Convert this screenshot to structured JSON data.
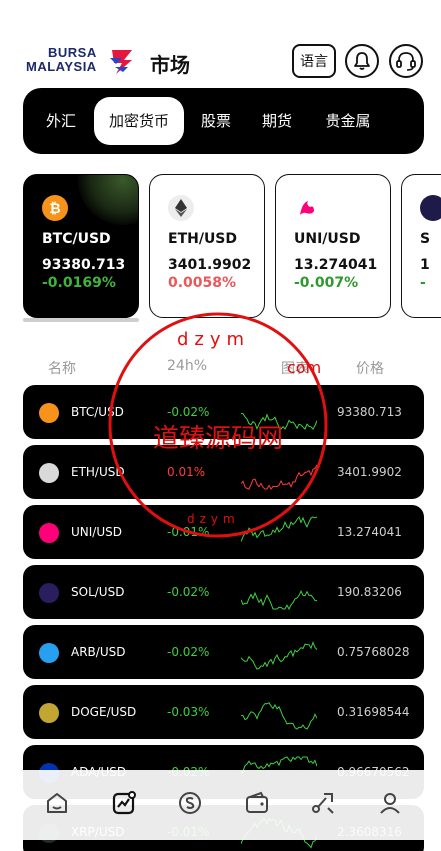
{
  "header": {
    "logo_line1": "BURSA",
    "logo_line2": "MALAYSIA",
    "title": "市场",
    "lang_label": "语言"
  },
  "tabs": [
    {
      "label": "外汇",
      "active": false
    },
    {
      "label": "加密货币",
      "active": true
    },
    {
      "label": "股票",
      "active": false
    },
    {
      "label": "期货",
      "active": false
    },
    {
      "label": "贵金属",
      "active": false
    }
  ],
  "cards": [
    {
      "pair": "BTC/USD",
      "price": "93380.713",
      "change": "-0.0169%",
      "change_color": "#3fb53f",
      "coin_color": "#f7931a",
      "dark": true
    },
    {
      "pair": "ETH/USD",
      "price": "3401.9902",
      "change": "0.0058%",
      "change_color": "#e65a5a",
      "coin_color": "#ededed",
      "dark": false
    },
    {
      "pair": "UNI/USD",
      "price": "13.274041",
      "change": "-0.007%",
      "change_color": "#2e9a2e",
      "coin_color": "#ffffff",
      "dark": false
    },
    {
      "pair": "S",
      "price": "1",
      "change": "-",
      "change_color": "#2e9a2e",
      "coin_color": "#1e1b4b",
      "dark": false
    }
  ],
  "table_header": {
    "name": "名称",
    "change": "24h%",
    "chart": "图表",
    "price": "价格"
  },
  "rows": [
    {
      "pair": "BTC/USD",
      "change": "-0.02%",
      "change_color": "#3fd13f",
      "price": "93380.713",
      "spark_color": "#3fd13f",
      "coin_color": "#f7931a",
      "icon": "bitcoin-icon"
    },
    {
      "pair": "ETH/USD",
      "change": "0.01%",
      "change_color": "#ff3b3b",
      "price": "3401.9902",
      "spark_color": "#ff3b3b",
      "coin_color": "#d9d9d9",
      "icon": "ethereum-icon"
    },
    {
      "pair": "UNI/USD",
      "change": "-0.01%",
      "change_color": "#3fd13f",
      "price": "13.274041",
      "spark_color": "#3fd13f",
      "coin_color": "#ff007a",
      "icon": "uniswap-icon"
    },
    {
      "pair": "SOL/USD",
      "change": "-0.02%",
      "change_color": "#3fd13f",
      "price": "190.83206",
      "spark_color": "#3fd13f",
      "coin_color": "#2a1f5c",
      "icon": "solana-icon"
    },
    {
      "pair": "ARB/USD",
      "change": "-0.02%",
      "change_color": "#3fd13f",
      "price": "0.75768028",
      "spark_color": "#3fd13f",
      "coin_color": "#28a0f0",
      "icon": "arbitrum-icon"
    },
    {
      "pair": "DOGE/USD",
      "change": "-0.03%",
      "change_color": "#3fd13f",
      "price": "0.31698544",
      "spark_color": "#3fd13f",
      "coin_color": "#c2a633",
      "icon": "dogecoin-icon"
    },
    {
      "pair": "ADA/USD",
      "change": "-0.02%",
      "change_color": "#3fd13f",
      "price": "0.96670562",
      "spark_color": "#3fd13f",
      "coin_color": "#0033ad",
      "icon": "cardano-icon"
    },
    {
      "pair": "XRP/USD",
      "change": "-0.01%",
      "change_color": "#3fd13f",
      "price": "2.3608316",
      "spark_color": "#3fd13f",
      "coin_color": "#23292f",
      "icon": "ripple-icon"
    }
  ],
  "bottom_nav": [
    {
      "icon": "home-icon",
      "active": false
    },
    {
      "icon": "market-chart-icon",
      "active": true
    },
    {
      "icon": "trade-coin-icon",
      "active": false
    },
    {
      "icon": "wallet-icon",
      "active": false
    },
    {
      "icon": "route-icon",
      "active": false
    },
    {
      "icon": "profile-icon",
      "active": false
    }
  ],
  "watermark": {
    "text": "道臻源码网",
    "url_text": "dzym",
    "url_suffix": "com",
    "color": "#e01010"
  }
}
